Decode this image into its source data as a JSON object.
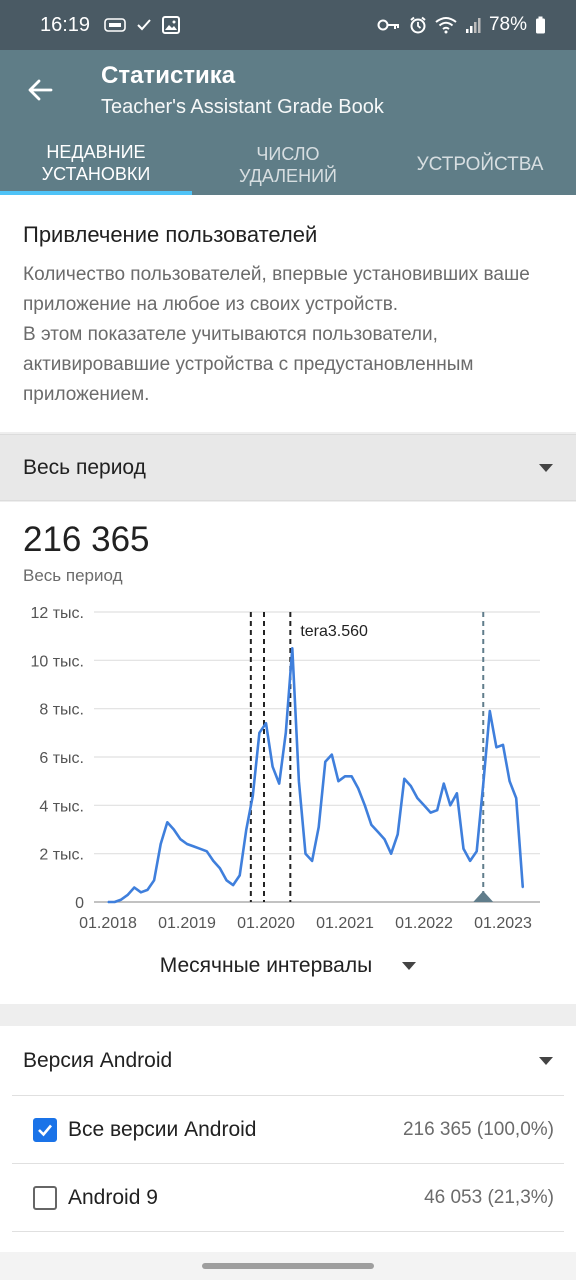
{
  "status": {
    "time": "16:19",
    "battery": "78%"
  },
  "appbar": {
    "title": "Статистика",
    "subtitle": "Teacher's Assistant Grade Book",
    "tabs": [
      {
        "line1": "НЕДАВНИЕ",
        "line2": "УСТАНОВКИ",
        "active": true
      },
      {
        "line1": "ЧИСЛО",
        "line2": "УДАЛЕНИЙ",
        "active": false
      },
      {
        "line1": "УСТРОЙСТВА",
        "line2": "",
        "active": false
      }
    ]
  },
  "description": {
    "heading": "Привлечение пользователей",
    "text1": "Количество пользователей, впервые установивших ваше приложение на любое из своих устройств.",
    "text2": "В этом показателе учитываются пользователи, активировавшие устройства с предустановленным приложением."
  },
  "period": {
    "label": "Весь период"
  },
  "summary": {
    "total": "216 365",
    "caption": "Весь период"
  },
  "chart_data": {
    "type": "line",
    "ylim": [
      0,
      12000
    ],
    "y_ticks": [
      {
        "value": 12000,
        "label": "12 тыс."
      },
      {
        "value": 10000,
        "label": "10 тыс."
      },
      {
        "value": 8000,
        "label": "8 тыс."
      },
      {
        "value": 6000,
        "label": "6 тыс."
      },
      {
        "value": 4000,
        "label": "4 тыс."
      },
      {
        "value": 2000,
        "label": "2 тыс."
      },
      {
        "value": 0,
        "label": "0"
      }
    ],
    "x_ticks": [
      "01.2018",
      "01.2019",
      "01.2020",
      "01.2021",
      "01.2022",
      "01.2023"
    ],
    "series_color": "#3f7fdc",
    "annotation": "tera3.560",
    "values": [
      0,
      0,
      100,
      300,
      600,
      400,
      500,
      900,
      2400,
      3300,
      3000,
      2600,
      2400,
      2300,
      2200,
      2100,
      1700,
      1400,
      900,
      700,
      1100,
      3000,
      4400,
      7000,
      7400,
      5600,
      4900,
      7000,
      10500,
      5000,
      2000,
      1700,
      3100,
      5800,
      6100,
      5000,
      5200,
      5200,
      4700,
      4000,
      3200,
      2900,
      2600,
      2000,
      2800,
      5100,
      4800,
      4300,
      4000,
      3700,
      3800,
      4900,
      4000,
      4500,
      2200,
      1700,
      2100,
      4900,
      7900,
      6400,
      6500,
      5000,
      4300,
      600
    ],
    "start": "01.2018"
  },
  "interval": {
    "label": "Месячные интервалы"
  },
  "android": {
    "header": "Версия Android",
    "rows": [
      {
        "label": "Все версии Android",
        "value": "216 365 (100,0%)",
        "checked": true
      },
      {
        "label": "Android 9",
        "value": "46 053 (21,3%)",
        "checked": false
      }
    ]
  }
}
